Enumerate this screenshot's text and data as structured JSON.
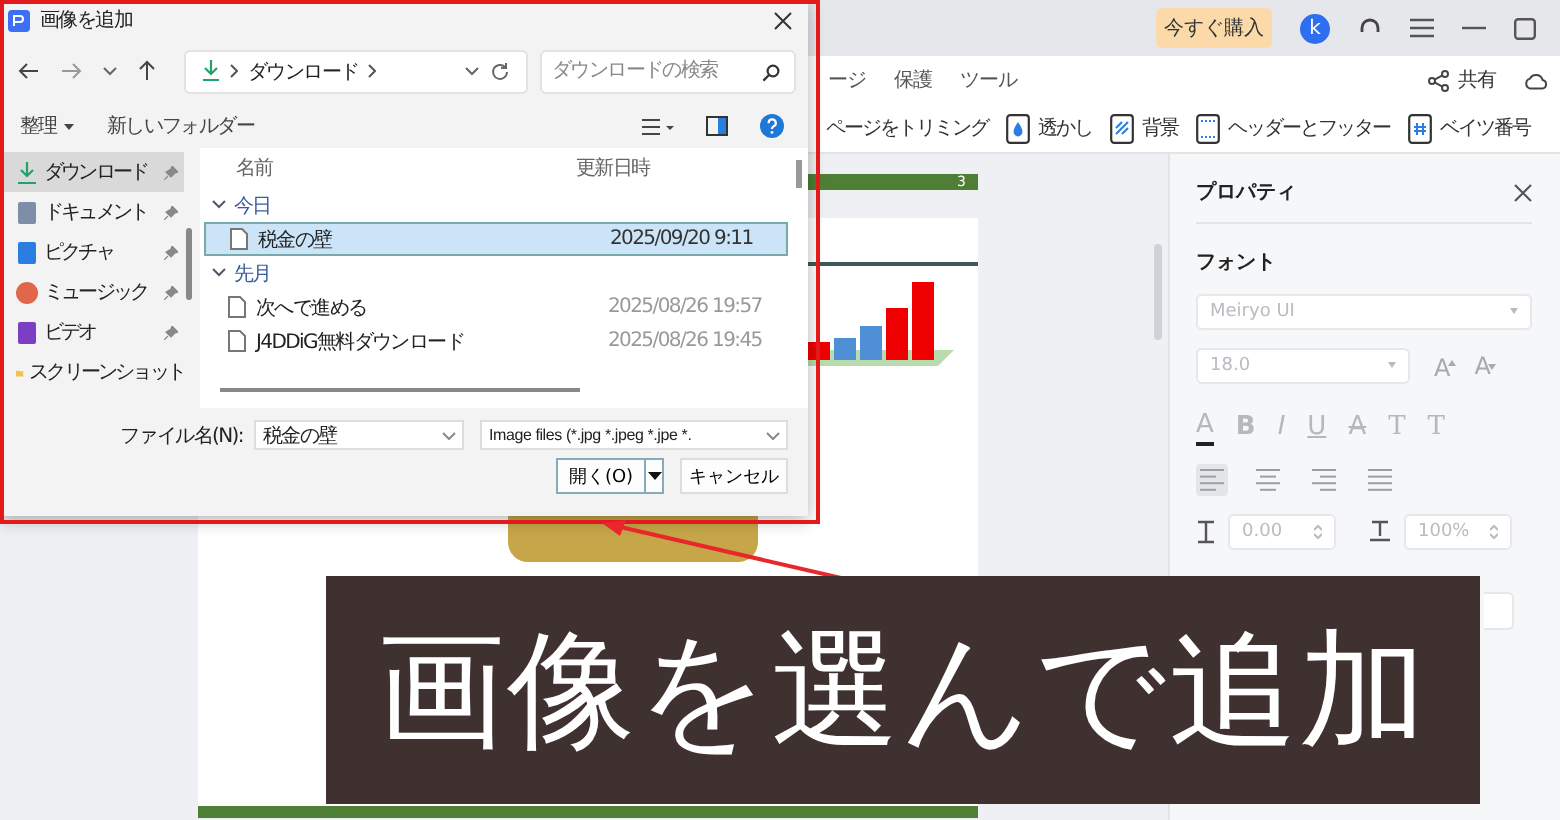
{
  "app": {
    "buy_button": "今すぐ購入",
    "avatar": "k",
    "menu_tabs": [
      "ージ",
      "保護",
      "ツール"
    ],
    "share": "共有",
    "toolbar": [
      {
        "kind": "text",
        "label": "ページをトリミング"
      },
      {
        "kind": "watermark",
        "label": "透かし"
      },
      {
        "kind": "background",
        "label": "背景"
      },
      {
        "kind": "header-footer",
        "label": "ヘッダーとフッター"
      },
      {
        "kind": "bates",
        "label": "ベイツ番号"
      }
    ]
  },
  "document": {
    "page_number": "3"
  },
  "properties": {
    "title": "プロパティ",
    "section": "フォント",
    "font_family": "Meiryo UI",
    "font_size": "18.0",
    "size_buttons": [
      {
        "kind": "grow",
        "glyph": "A"
      },
      {
        "kind": "shrink",
        "glyph": "A"
      }
    ],
    "format_buttons": [
      {
        "kind": "color",
        "glyph": "A"
      },
      {
        "kind": "bold",
        "glyph": "B"
      },
      {
        "kind": "italic",
        "glyph": "I"
      },
      {
        "kind": "underline",
        "glyph": "U"
      },
      {
        "kind": "strike",
        "glyph": "A"
      },
      {
        "kind": "sup",
        "glyph": "T"
      },
      {
        "kind": "sub",
        "glyph": "T"
      }
    ],
    "align_buttons": [
      {
        "kind": "left",
        "selected": true
      },
      {
        "kind": "center",
        "selected": false
      },
      {
        "kind": "right",
        "selected": false
      },
      {
        "kind": "justify",
        "selected": false
      }
    ],
    "line_spacing": "0.00",
    "char_scale": "100%"
  },
  "dialog": {
    "title": "画像を追加",
    "address": "ダウンロード",
    "search_placeholder": "ダウンロードの検索",
    "commands": [
      "整理",
      "新しいフォルダー"
    ],
    "nav_items": [
      {
        "kind": "download",
        "label": "ダウンロード",
        "pinned": true,
        "selected": true
      },
      {
        "kind": "document",
        "label": "ドキュメント",
        "pinned": true,
        "selected": false
      },
      {
        "kind": "picture",
        "label": "ピクチャ",
        "pinned": true,
        "selected": false
      },
      {
        "kind": "music",
        "label": "ミュージック",
        "pinned": true,
        "selected": false
      },
      {
        "kind": "video",
        "label": "ビデオ",
        "pinned": true,
        "selected": false
      },
      {
        "kind": "folder",
        "label": "スクリーンショット",
        "pinned": false,
        "selected": false
      }
    ],
    "columns": [
      "名前",
      "更新日時"
    ],
    "groups": [
      {
        "label": "今日",
        "files": [
          {
            "name": "税金の壁",
            "date": "2025/09/20 9:11",
            "selected": true
          }
        ]
      },
      {
        "label": "先月",
        "files": [
          {
            "name": "次へで進める",
            "date": "2025/08/26 19:57",
            "selected": false
          },
          {
            "name": "J4DDiG無料ダウンロード",
            "date": "2025/08/26 19:45",
            "selected": false
          }
        ]
      }
    ],
    "filename_label": "ファイル名(N):",
    "filename": "税金の壁",
    "filetype": "Image files (*.jpg *.jpeg *.jpe *.",
    "open_button": "開く(O)",
    "cancel_button": "キャンセル"
  },
  "caption": "画像を選んで追加"
}
